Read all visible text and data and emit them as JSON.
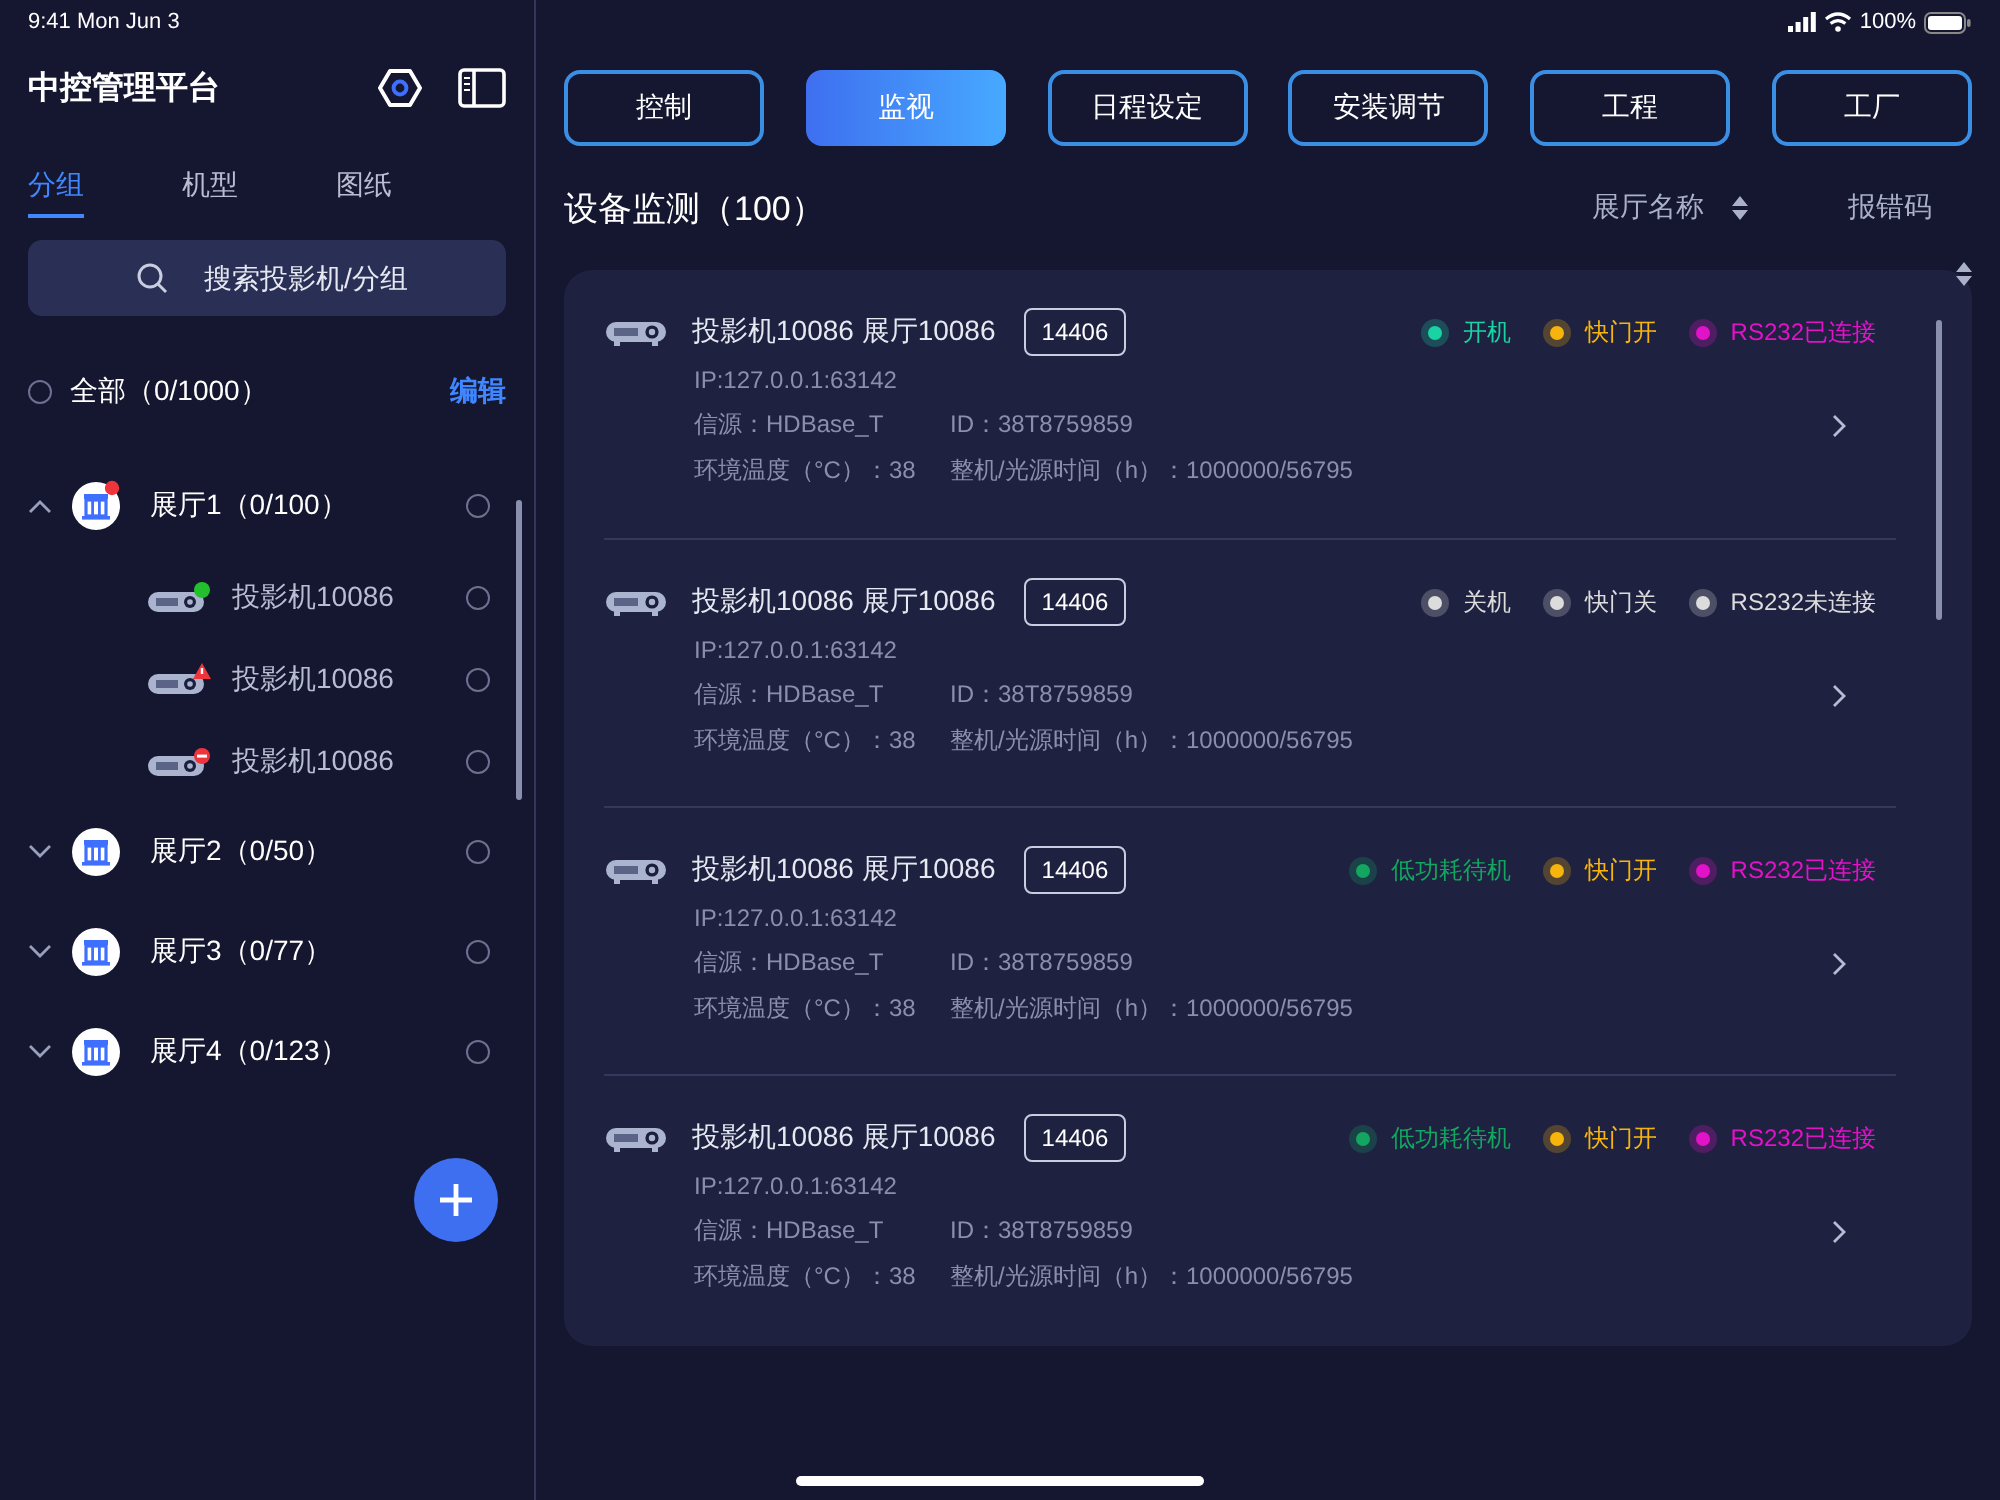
{
  "status_bar": {
    "time": "9:41 Mon Jun 3",
    "battery": "100%"
  },
  "sidebar": {
    "title": "中控管理平台",
    "tabs": [
      {
        "label": "分组",
        "selected": true
      },
      {
        "label": "机型",
        "selected": false
      },
      {
        "label": "图纸",
        "selected": false
      }
    ],
    "search": {
      "placeholder": "搜索投影机/分组"
    },
    "all": {
      "label": "全部（0/1000）",
      "selected": false,
      "edit": "编辑"
    },
    "groups": [
      {
        "label": "展厅1（0/100）",
        "expanded": true,
        "alert": true,
        "selected": false,
        "children": [
          {
            "label": "投影机10086",
            "kind": "online",
            "selected": false
          },
          {
            "label": "投影机10086",
            "kind": "warning",
            "selected": false
          },
          {
            "label": "投影机10086",
            "kind": "error",
            "selected": false
          }
        ]
      },
      {
        "label": "展厅2（0/50）",
        "expanded": false,
        "alert": false,
        "selected": false
      },
      {
        "label": "展厅3（0/77）",
        "expanded": false,
        "alert": false,
        "selected": false
      },
      {
        "label": "展厅4（0/123）",
        "expanded": false,
        "alert": false,
        "selected": false
      }
    ]
  },
  "tabs": [
    {
      "label": "控制",
      "selected": false
    },
    {
      "label": "监视",
      "selected": true
    },
    {
      "label": "日程设定",
      "selected": false
    },
    {
      "label": "安装调节",
      "selected": false
    },
    {
      "label": "工程",
      "selected": false
    },
    {
      "label": "工厂",
      "selected": false
    }
  ],
  "list_header": {
    "title": "设备监测（100）",
    "sort": "展厅名称",
    "error_code": "报错码"
  },
  "devices": [
    {
      "name": "投影机10086 展厅10086",
      "code": "14406",
      "ip": "IP:127.0.0.1:63142",
      "source": "信源：HDBase_T",
      "id": "ID：38T8759859",
      "temp": "环境温度（°C）：38",
      "hours": "整机/光源时间（h）：1000000/56795",
      "statuses": [
        {
          "label": "开机",
          "color": "#19d3a4"
        },
        {
          "label": "快门开",
          "color": "#f6b40c"
        },
        {
          "label": "RS232已连接",
          "color": "#e212c8"
        }
      ]
    },
    {
      "name": "投影机10086 展厅10086",
      "code": "14406",
      "ip": "IP:127.0.0.1:63142",
      "source": "信源：HDBase_T",
      "id": "ID：38T8759859",
      "temp": "环境温度（°C）：38",
      "hours": "整机/光源时间（h）：1000000/56795",
      "statuses": [
        {
          "label": "关机",
          "color": "#dcdcdc"
        },
        {
          "label": "快门关",
          "color": "#dcdcdc"
        },
        {
          "label": "RS232未连接",
          "color": "#dcdcdc"
        }
      ]
    },
    {
      "name": "投影机10086 展厅10086",
      "code": "14406",
      "ip": "IP:127.0.0.1:63142",
      "source": "信源：HDBase_T",
      "id": "ID：38T8759859",
      "temp": "环境温度（°C）：38",
      "hours": "整机/光源时间（h）：1000000/56795",
      "statuses": [
        {
          "label": "低功耗待机",
          "color": "#12a660"
        },
        {
          "label": "快门开",
          "color": "#f6b40c"
        },
        {
          "label": "RS232已连接",
          "color": "#e212c8"
        }
      ]
    },
    {
      "name": "投影机10086 展厅10086",
      "code": "14406",
      "ip": "IP:127.0.0.1:63142",
      "source": "信源：HDBase_T",
      "id": "ID：38T8759859",
      "temp": "环境温度（°C）：38",
      "hours": "整机/光源时间（h）：1000000/56795",
      "statuses": [
        {
          "label": "低功耗待机",
          "color": "#12a660"
        },
        {
          "label": "快门开",
          "color": "#f6b40c"
        },
        {
          "label": "RS232已连接",
          "color": "#e212c8"
        }
      ]
    }
  ]
}
